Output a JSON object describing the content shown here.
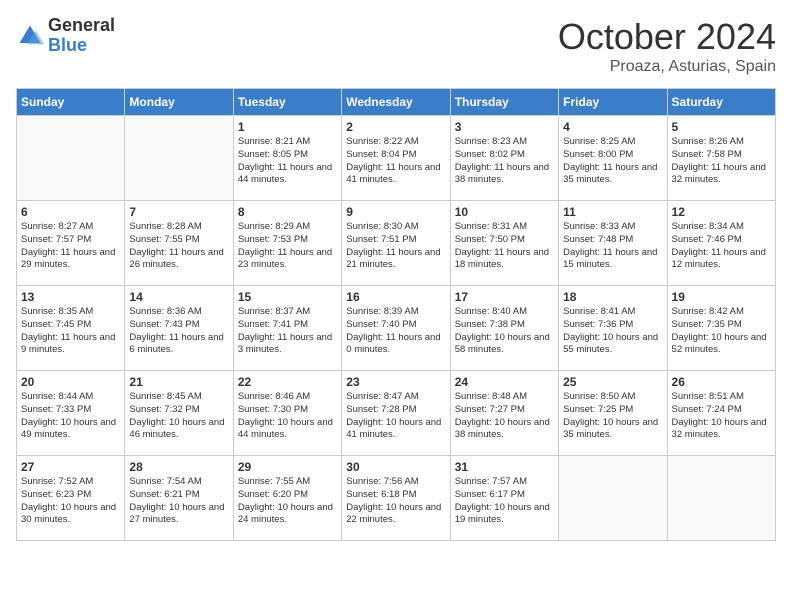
{
  "header": {
    "logo_general": "General",
    "logo_blue": "Blue",
    "month": "October 2024",
    "location": "Proaza, Asturias, Spain"
  },
  "columns": [
    "Sunday",
    "Monday",
    "Tuesday",
    "Wednesday",
    "Thursday",
    "Friday",
    "Saturday"
  ],
  "weeks": [
    [
      {
        "day": "",
        "info": ""
      },
      {
        "day": "",
        "info": ""
      },
      {
        "day": "1",
        "info": "Sunrise: 8:21 AM\nSunset: 8:05 PM\nDaylight: 11 hours and 44 minutes."
      },
      {
        "day": "2",
        "info": "Sunrise: 8:22 AM\nSunset: 8:04 PM\nDaylight: 11 hours and 41 minutes."
      },
      {
        "day": "3",
        "info": "Sunrise: 8:23 AM\nSunset: 8:02 PM\nDaylight: 11 hours and 38 minutes."
      },
      {
        "day": "4",
        "info": "Sunrise: 8:25 AM\nSunset: 8:00 PM\nDaylight: 11 hours and 35 minutes."
      },
      {
        "day": "5",
        "info": "Sunrise: 8:26 AM\nSunset: 7:58 PM\nDaylight: 11 hours and 32 minutes."
      }
    ],
    [
      {
        "day": "6",
        "info": "Sunrise: 8:27 AM\nSunset: 7:57 PM\nDaylight: 11 hours and 29 minutes."
      },
      {
        "day": "7",
        "info": "Sunrise: 8:28 AM\nSunset: 7:55 PM\nDaylight: 11 hours and 26 minutes."
      },
      {
        "day": "8",
        "info": "Sunrise: 8:29 AM\nSunset: 7:53 PM\nDaylight: 11 hours and 23 minutes."
      },
      {
        "day": "9",
        "info": "Sunrise: 8:30 AM\nSunset: 7:51 PM\nDaylight: 11 hours and 21 minutes."
      },
      {
        "day": "10",
        "info": "Sunrise: 8:31 AM\nSunset: 7:50 PM\nDaylight: 11 hours and 18 minutes."
      },
      {
        "day": "11",
        "info": "Sunrise: 8:33 AM\nSunset: 7:48 PM\nDaylight: 11 hours and 15 minutes."
      },
      {
        "day": "12",
        "info": "Sunrise: 8:34 AM\nSunset: 7:46 PM\nDaylight: 11 hours and 12 minutes."
      }
    ],
    [
      {
        "day": "13",
        "info": "Sunrise: 8:35 AM\nSunset: 7:45 PM\nDaylight: 11 hours and 9 minutes."
      },
      {
        "day": "14",
        "info": "Sunrise: 8:36 AM\nSunset: 7:43 PM\nDaylight: 11 hours and 6 minutes."
      },
      {
        "day": "15",
        "info": "Sunrise: 8:37 AM\nSunset: 7:41 PM\nDaylight: 11 hours and 3 minutes."
      },
      {
        "day": "16",
        "info": "Sunrise: 8:39 AM\nSunset: 7:40 PM\nDaylight: 11 hours and 0 minutes."
      },
      {
        "day": "17",
        "info": "Sunrise: 8:40 AM\nSunset: 7:38 PM\nDaylight: 10 hours and 58 minutes."
      },
      {
        "day": "18",
        "info": "Sunrise: 8:41 AM\nSunset: 7:36 PM\nDaylight: 10 hours and 55 minutes."
      },
      {
        "day": "19",
        "info": "Sunrise: 8:42 AM\nSunset: 7:35 PM\nDaylight: 10 hours and 52 minutes."
      }
    ],
    [
      {
        "day": "20",
        "info": "Sunrise: 8:44 AM\nSunset: 7:33 PM\nDaylight: 10 hours and 49 minutes."
      },
      {
        "day": "21",
        "info": "Sunrise: 8:45 AM\nSunset: 7:32 PM\nDaylight: 10 hours and 46 minutes."
      },
      {
        "day": "22",
        "info": "Sunrise: 8:46 AM\nSunset: 7:30 PM\nDaylight: 10 hours and 44 minutes."
      },
      {
        "day": "23",
        "info": "Sunrise: 8:47 AM\nSunset: 7:28 PM\nDaylight: 10 hours and 41 minutes."
      },
      {
        "day": "24",
        "info": "Sunrise: 8:48 AM\nSunset: 7:27 PM\nDaylight: 10 hours and 38 minutes."
      },
      {
        "day": "25",
        "info": "Sunrise: 8:50 AM\nSunset: 7:25 PM\nDaylight: 10 hours and 35 minutes."
      },
      {
        "day": "26",
        "info": "Sunrise: 8:51 AM\nSunset: 7:24 PM\nDaylight: 10 hours and 32 minutes."
      }
    ],
    [
      {
        "day": "27",
        "info": "Sunrise: 7:52 AM\nSunset: 6:23 PM\nDaylight: 10 hours and 30 minutes."
      },
      {
        "day": "28",
        "info": "Sunrise: 7:54 AM\nSunset: 6:21 PM\nDaylight: 10 hours and 27 minutes."
      },
      {
        "day": "29",
        "info": "Sunrise: 7:55 AM\nSunset: 6:20 PM\nDaylight: 10 hours and 24 minutes."
      },
      {
        "day": "30",
        "info": "Sunrise: 7:56 AM\nSunset: 6:18 PM\nDaylight: 10 hours and 22 minutes."
      },
      {
        "day": "31",
        "info": "Sunrise: 7:57 AM\nSunset: 6:17 PM\nDaylight: 10 hours and 19 minutes."
      },
      {
        "day": "",
        "info": ""
      },
      {
        "day": "",
        "info": ""
      }
    ]
  ]
}
